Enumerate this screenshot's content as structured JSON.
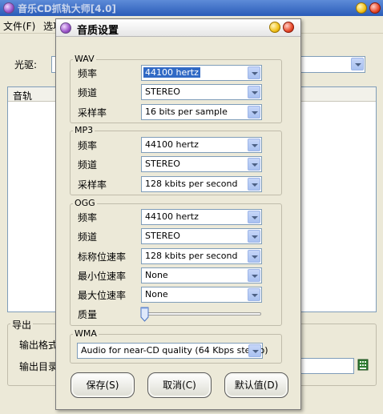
{
  "main_window": {
    "title": "音乐CD抓轨大师[4.0]",
    "menu": [
      "文件(F)",
      "选项"
    ],
    "drive_label": "光驱:",
    "track_column": "音轨",
    "export_label": "导出",
    "output_format_label": "输出格式",
    "output_dir_label": "输出目录"
  },
  "dialog": {
    "title": "音质设置",
    "wav": {
      "label": "WAV",
      "rows": [
        {
          "label": "频率",
          "value": "44100 hertz"
        },
        {
          "label": "频道",
          "value": "STEREO"
        },
        {
          "label": "采样率",
          "value": "16 bits per sample"
        }
      ]
    },
    "mp3": {
      "label": "MP3",
      "rows": [
        {
          "label": "频率",
          "value": "44100 hertz"
        },
        {
          "label": "频道",
          "value": "STEREO"
        },
        {
          "label": "采样率",
          "value": "128 kbits per second"
        }
      ]
    },
    "ogg": {
      "label": "OGG",
      "rows": [
        {
          "label": "频率",
          "value": "44100 hertz"
        },
        {
          "label": "频道",
          "value": "STEREO"
        },
        {
          "label": "标称位速率",
          "value": "128 kbits per second"
        },
        {
          "label": "最小位速率",
          "value": "None"
        },
        {
          "label": "最大位速率",
          "value": "None"
        }
      ],
      "quality_label": "质量",
      "quality_level": 0
    },
    "wma": {
      "label": "WMA",
      "value": "Audio for near-CD quality (64 Kbps stereo)"
    },
    "buttons": {
      "save": "保存(S)",
      "cancel": "取消(C)",
      "default": "默认值(D)"
    }
  },
  "colors": {
    "main_title_bar": "#2a5cb8",
    "selection": "#316ac5",
    "dialog_face": "#ece9d8"
  }
}
